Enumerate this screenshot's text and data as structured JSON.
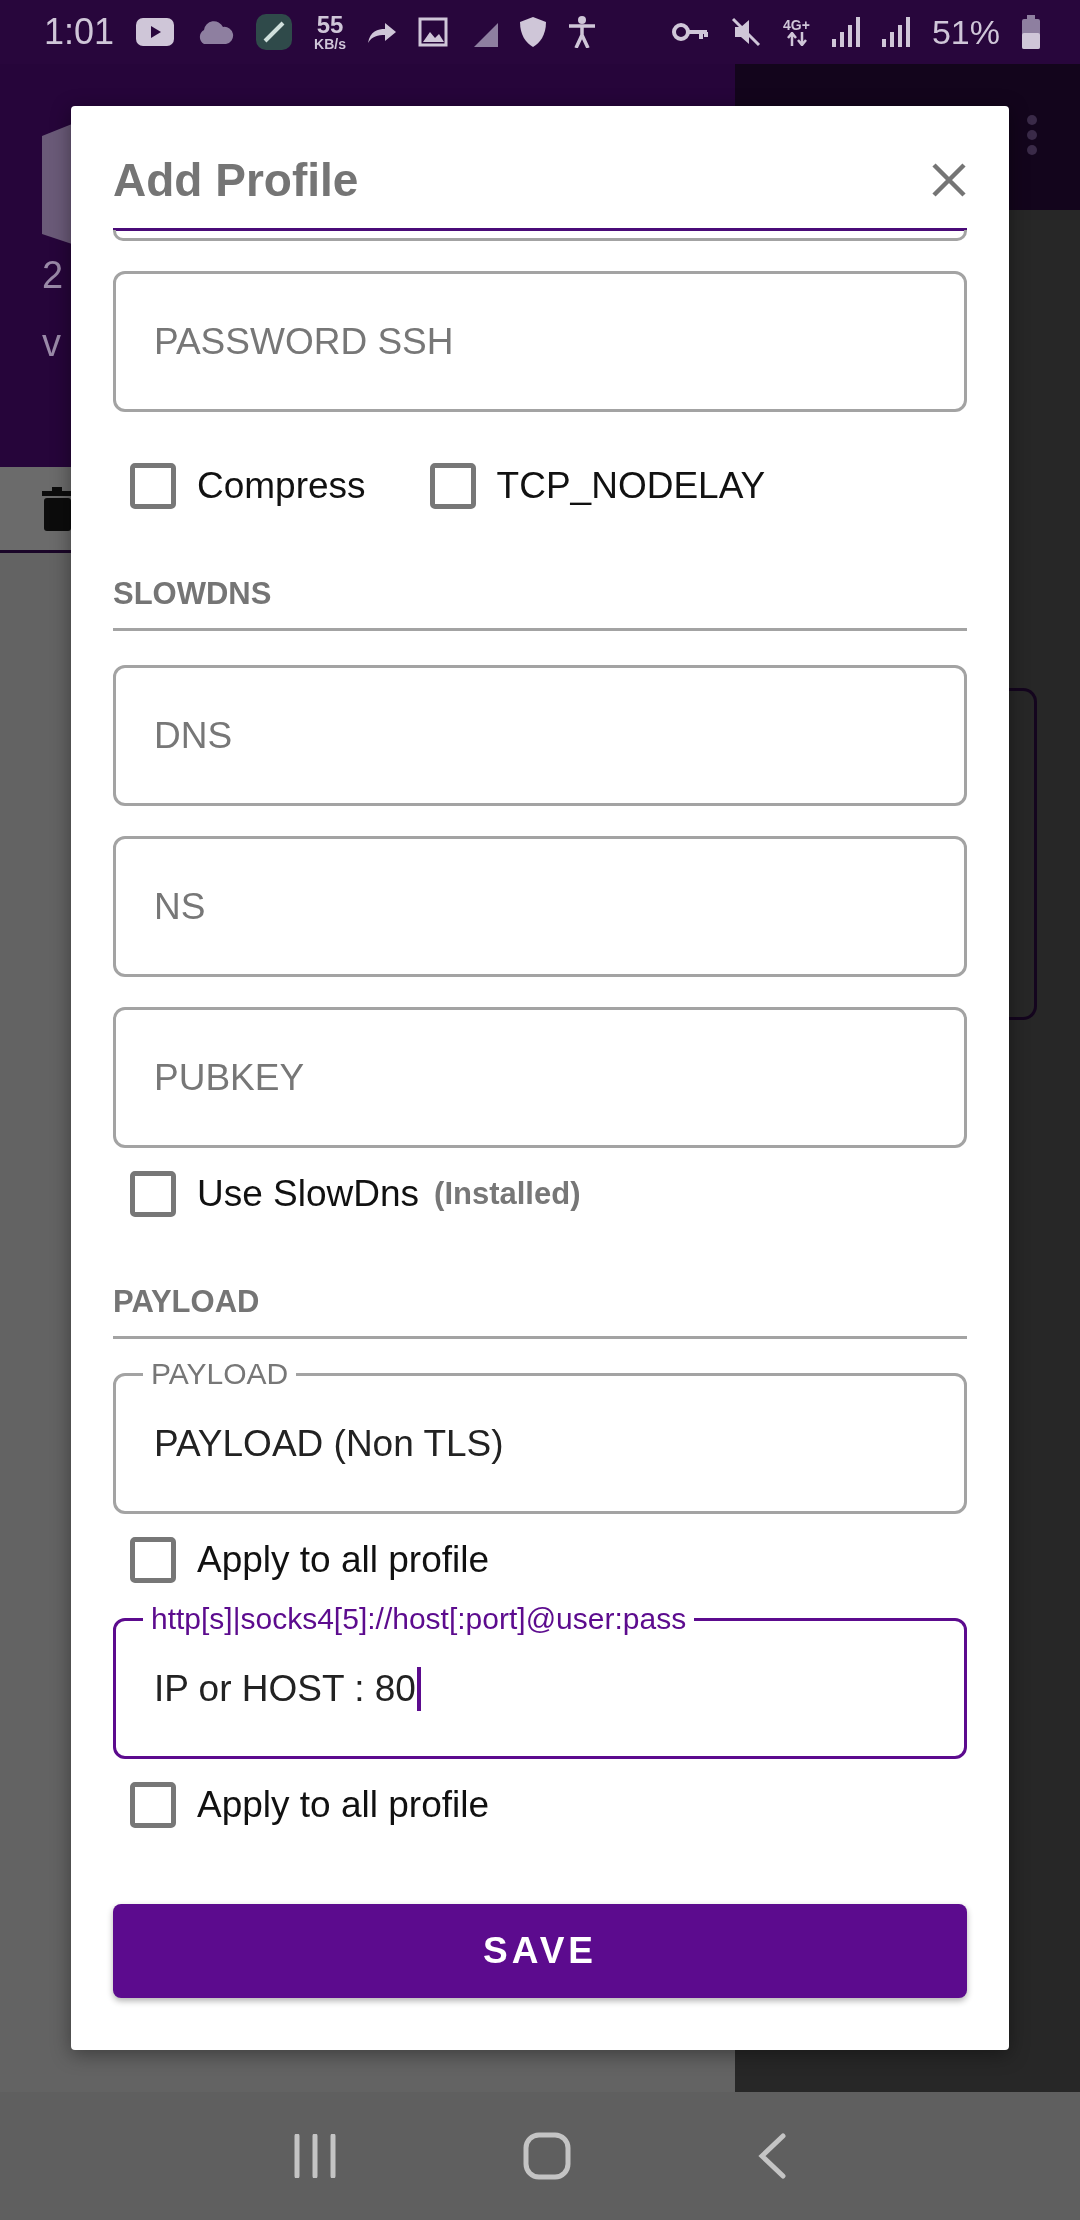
{
  "status_bar": {
    "time": "1:01",
    "net_speed": "55",
    "net_unit": "KB/s",
    "network_type": "4G+",
    "battery": "51%"
  },
  "background_app": {
    "texts": [
      "2",
      "v"
    ]
  },
  "dialog": {
    "title": "Add Profile",
    "items": [
      {
        "kind": "field",
        "placeholder": "PASSWORD SSH"
      },
      {
        "kind": "checks",
        "options": [
          {
            "label": "Compress",
            "checked": false
          },
          {
            "label": "TCP_NODELAY",
            "checked": false
          }
        ]
      },
      {
        "kind": "section",
        "title": "SLOWDNS"
      },
      {
        "kind": "field",
        "placeholder": "DNS"
      },
      {
        "kind": "field",
        "placeholder": "NS"
      },
      {
        "kind": "field",
        "placeholder": "PUBKEY"
      },
      {
        "kind": "checks",
        "options": [
          {
            "label": "Use SlowDns",
            "note": "(Installed)",
            "checked": false
          }
        ]
      },
      {
        "kind": "section",
        "title": "PAYLOAD"
      },
      {
        "kind": "field",
        "label": "PAYLOAD",
        "value": "PAYLOAD (Non TLS)",
        "focused": false
      },
      {
        "kind": "checks",
        "options": [
          {
            "label": "Apply to all profile",
            "checked": false
          }
        ]
      },
      {
        "kind": "field",
        "label": "http[s]|socks4[5]://host[:port]@user:pass",
        "value": "IP or HOST : 80",
        "focused": true
      },
      {
        "kind": "checks",
        "options": [
          {
            "label": "Apply to all profile",
            "checked": false
          }
        ]
      }
    ],
    "save_button": "SAVE"
  }
}
